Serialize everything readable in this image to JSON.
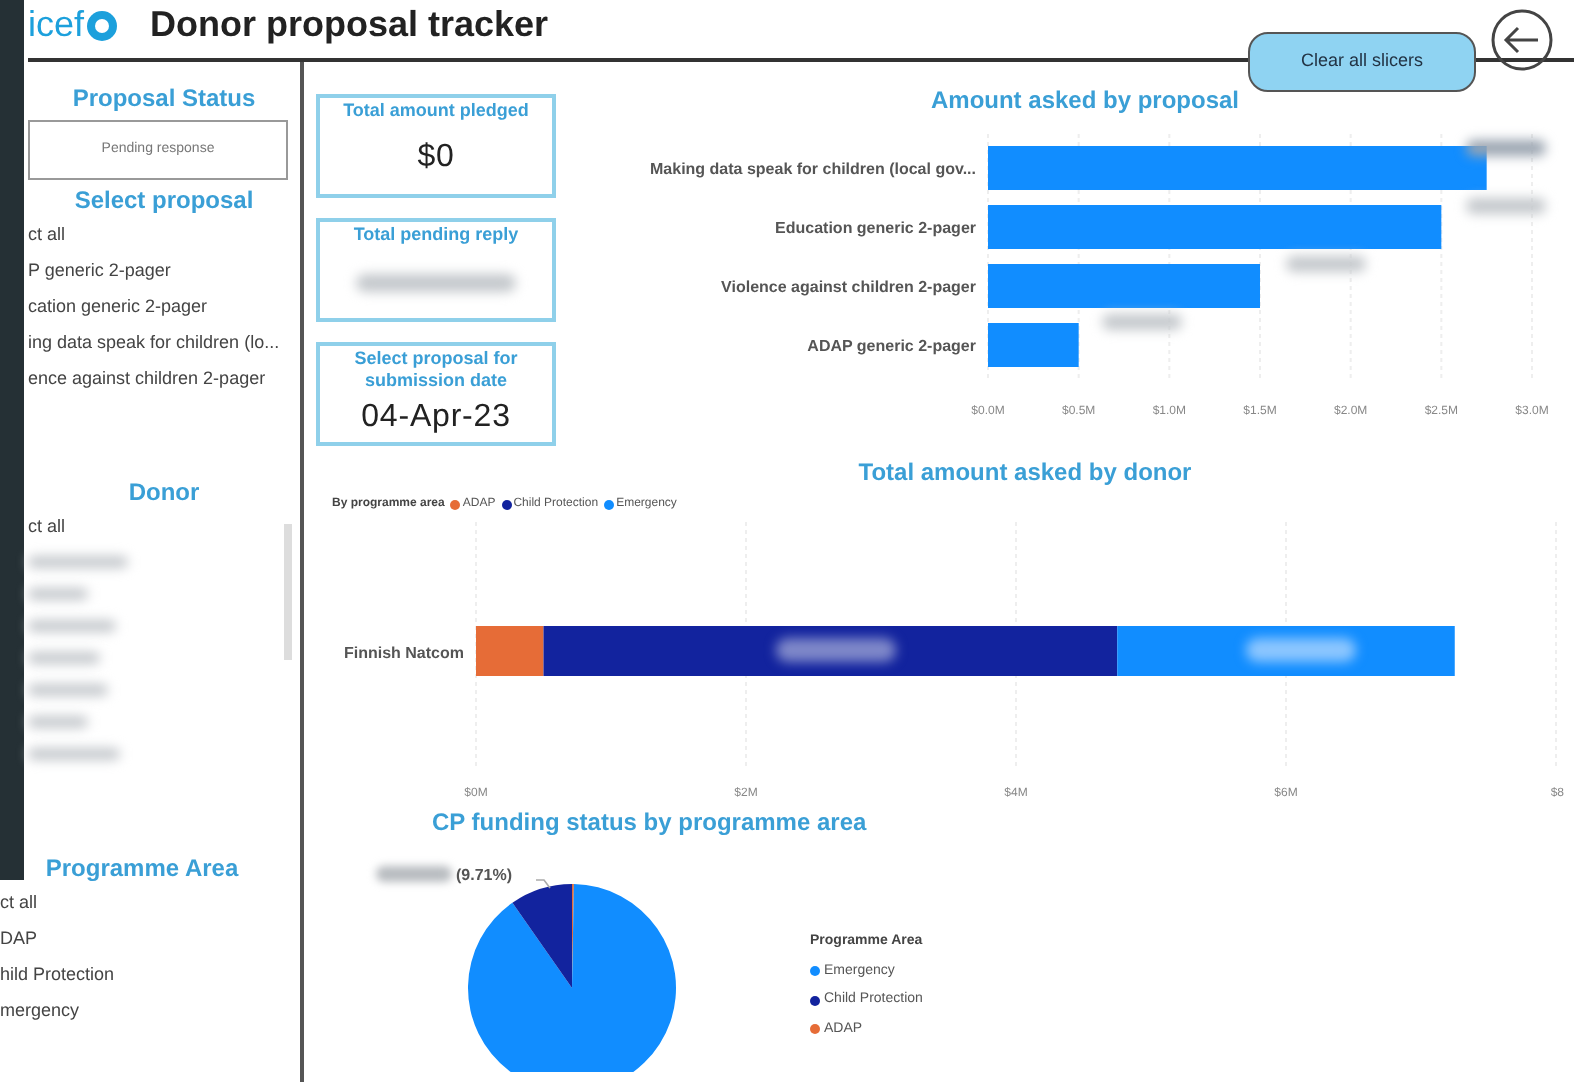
{
  "header": {
    "logo_text": "icef",
    "title": "Donor proposal tracker",
    "clear_button": "Clear all slicers"
  },
  "sidebar": [
    {
      "title": "Proposal Status",
      "kind": "dropdown",
      "value": "Pending response"
    },
    {
      "title": "Select proposal",
      "kind": "list",
      "items": [
        "ct all",
        "P generic 2-pager",
        "cation generic 2-pager",
        "ing data speak for children (lo...",
        "ence against children 2-pager"
      ]
    },
    {
      "title": "Donor",
      "kind": "blurred-list",
      "items": [
        "ct all"
      ]
    },
    {
      "title": "Programme Area",
      "kind": "list",
      "items": [
        "ct all",
        "DAP",
        "hild Protection",
        "mergency"
      ]
    }
  ],
  "cards": [
    {
      "title": "Total amount pledged",
      "value": "$0"
    },
    {
      "title": "Total pending reply"
    },
    {
      "title": "Select proposal for submission date",
      "value": "04-Apr-23"
    }
  ],
  "proposal_chart": {
    "title": "Amount asked by proposal",
    "chart_data": {
      "type": "bar",
      "orientation": "horizontal",
      "grid": true,
      "categories": [
        "Making data speak for children (local gov...",
        "Education generic 2-pager",
        "Violence against children 2-pager",
        "ADAP generic 2-pager"
      ],
      "values": [
        2.75,
        2.5,
        1.5,
        0.5
      ],
      "xlim": [
        0,
        3
      ],
      "xticks": [
        {
          "value": 0,
          "label": "$0.0M"
        },
        {
          "value": 0.5,
          "label": "$0.5M"
        },
        {
          "value": 1,
          "label": "$1.0M"
        },
        {
          "value": 1.5,
          "label": "$1.5M"
        },
        {
          "value": 2,
          "label": "$2.0M"
        },
        {
          "value": 2.5,
          "label": "$2.5M"
        },
        {
          "value": 3,
          "label": "$3.0M"
        }
      ]
    }
  },
  "donor_chart": {
    "title": "Total amount asked by donor",
    "chart_data": {
      "type": "bar",
      "orientation": "horizontal",
      "stacked": true,
      "grid": true,
      "categories": [
        "Finnish Natcom"
      ],
      "series": [
        {
          "name": "ADAP",
          "color": "#e66c37",
          "values": [
            0.5
          ]
        },
        {
          "name": "Child Protection",
          "color": "#12239e",
          "values": [
            4.25
          ]
        },
        {
          "name": "Emergency",
          "color": "#118dff",
          "values": [
            2.5
          ]
        }
      ],
      "xlim": [
        0,
        8
      ],
      "xticks": [
        {
          "value": 0,
          "label": "$0M"
        },
        {
          "value": 2,
          "label": "$2M"
        },
        {
          "value": 4,
          "label": "$4M"
        },
        {
          "value": 6,
          "label": "$6M"
        },
        {
          "value": 8,
          "label": "$8"
        }
      ]
    },
    "legend_title": "By programme area"
  },
  "pie_chart": {
    "title": "CP funding status by programme area",
    "legend_title": "Programme Area",
    "chart_data": {
      "type": "pie",
      "values": [
        90,
        9.71,
        0.29
      ],
      "categories": [
        "Emergency",
        "Child Protection",
        "ADAP"
      ],
      "colors": [
        "#118dff",
        "#12239e",
        "#e66c37"
      ],
      "annotations": [
        "(9.71%)"
      ]
    }
  }
}
